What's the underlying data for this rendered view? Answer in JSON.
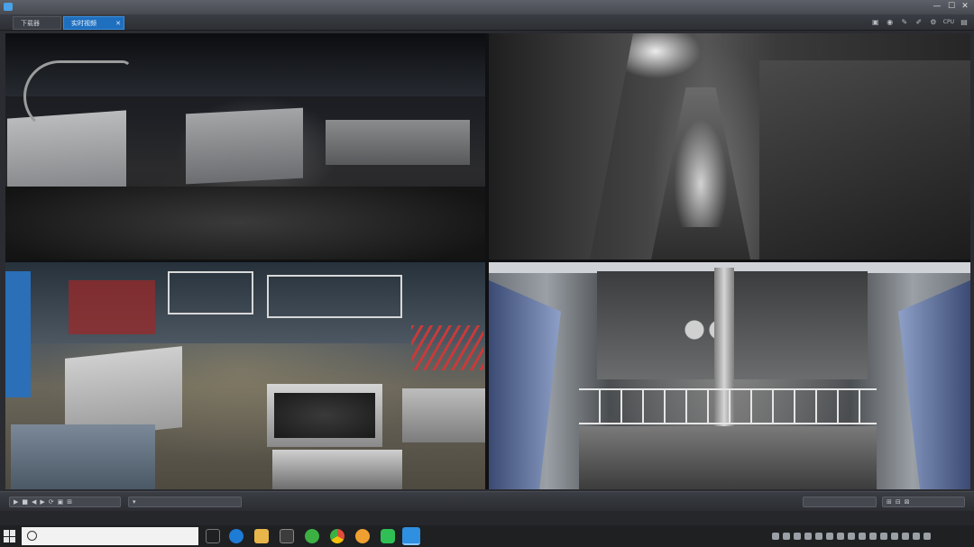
{
  "window": {
    "title": "",
    "min_glyph": "—",
    "max_glyph": "☐",
    "close_glyph": "✕"
  },
  "tabs": [
    {
      "label": "下载器"
    },
    {
      "label": "实时视频",
      "close": "✕"
    }
  ],
  "toolbar": {
    "icons": [
      "display-icon",
      "record-icon",
      "wrench-icon",
      "brush-icon",
      "settings-icon",
      "cpu-icon"
    ],
    "readout": "CPU"
  },
  "cameras": [
    {
      "label": ""
    },
    {
      "label": ""
    },
    {
      "label": ""
    },
    {
      "label": ""
    }
  ],
  "controls": {
    "left_buttons": [
      "▶",
      "■",
      "◀",
      "▶",
      "⟳",
      "▣",
      "⊞"
    ],
    "right_buttons": [
      "⊞",
      "⊟",
      "⊠"
    ]
  },
  "links": [
    "",
    "",
    "",
    ""
  ],
  "taskbar": {
    "search_placeholder": "",
    "clock_time": "",
    "clock_date": "",
    "colors": {
      "edge": "#1e7bd6",
      "folder": "#e8b64a",
      "green": "#3cb043",
      "chrome": "#e24d3a",
      "orange": "#f0a030",
      "wechat": "#2fbf55",
      "app": "#2f8fe0"
    }
  }
}
